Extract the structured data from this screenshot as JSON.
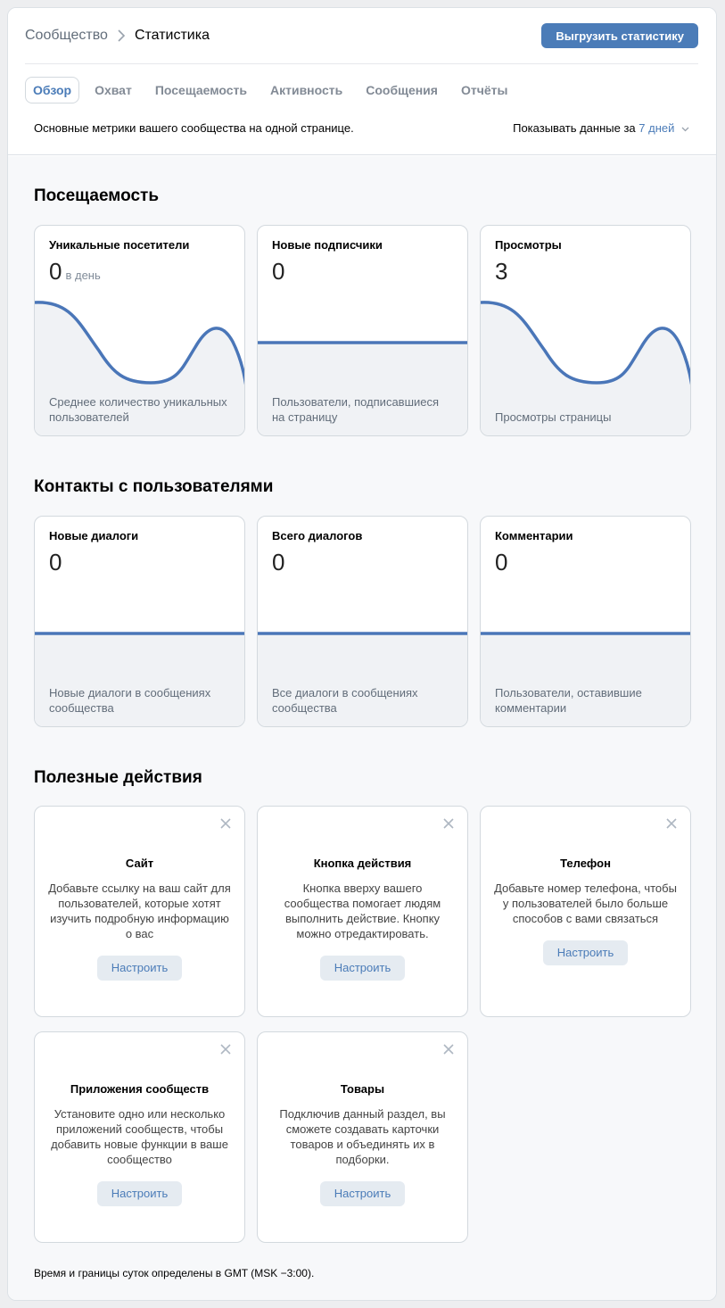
{
  "breadcrumb": {
    "parent": "Сообщество",
    "current": "Статистика"
  },
  "header": {
    "export_button": "Выгрузить статистику"
  },
  "tabs": [
    {
      "label": "Обзор",
      "active": true
    },
    {
      "label": "Охват"
    },
    {
      "label": "Посещаемость"
    },
    {
      "label": "Активность"
    },
    {
      "label": "Сообщения"
    },
    {
      "label": "Отчёты"
    }
  ],
  "subheader": {
    "description": "Основные метрики вашего сообщества на одной странице.",
    "range_prefix": "Показывать данные за",
    "range_value": "7 дней"
  },
  "colors": {
    "accent": "#4b7cb8",
    "line": "#4a76b8",
    "fill": "#f0f2f5"
  },
  "sections": {
    "attendance": {
      "title": "Посещаемость",
      "cards": [
        {
          "title": "Уникальные посетители",
          "value": "0",
          "unit": "в день",
          "desc": "Среднее количество уникальных пользователей",
          "chart": "wave"
        },
        {
          "title": "Новые подписчики",
          "value": "0",
          "unit": "",
          "desc": "Пользователи, подписавшиеся на страницу",
          "chart": "flat"
        },
        {
          "title": "Просмотры",
          "value": "3",
          "unit": "",
          "desc": "Просмотры страницы",
          "chart": "wave"
        }
      ]
    },
    "contacts": {
      "title": "Контакты с пользователями",
      "cards": [
        {
          "title": "Новые диалоги",
          "value": "0",
          "desc": "Новые диалоги в сообщениях сообщества",
          "chart": "flat"
        },
        {
          "title": "Всего диалогов",
          "value": "0",
          "desc": "Все диалоги в сообщениях сообщества",
          "chart": "flat"
        },
        {
          "title": "Комментарии",
          "value": "0",
          "desc": "Пользователи, оставившие комментарии",
          "chart": "flat"
        }
      ]
    },
    "actions": {
      "title": "Полезные действия",
      "cards": [
        {
          "title": "Сайт",
          "text": "Добавьте ссылку на ваш сайт для пользователей, которые хотят изучить подробную информацию о вас",
          "button": "Настроить"
        },
        {
          "title": "Кнопка действия",
          "text": "Кнопка вверху вашего сообщества помогает людям выполнить действие. Кнопку можно отредактировать.",
          "button": "Настроить"
        },
        {
          "title": "Телефон",
          "text": "Добавьте номер телефона, чтобы у пользователей было больше способов с вами связаться",
          "button": "Настроить"
        },
        {
          "title": "Приложения сообществ",
          "text": "Установите одно или несколько приложений сообществ, чтобы добавить новые функции в ваше сообщество",
          "button": "Настроить"
        },
        {
          "title": "Товары",
          "text": "Подключив данный раздел, вы сможете создавать карточки товаров и объединять их в подборки.",
          "button": "Настроить"
        }
      ]
    }
  },
  "footer": "Время и границы суток определены в GMT (MSK −3:00)."
}
